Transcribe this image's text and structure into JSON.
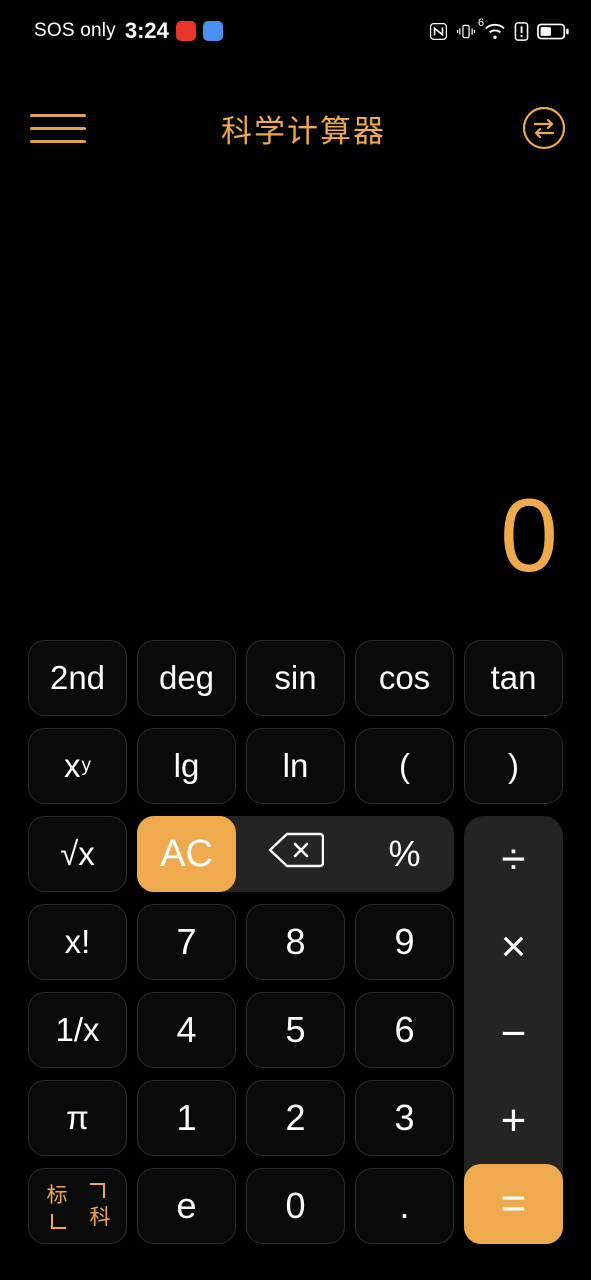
{
  "statusbar": {
    "carrier": "SOS only",
    "time": "3:24",
    "badges": [
      {
        "name": "notification-badge-red",
        "color": "#e8352b",
        "glyph": ""
      },
      {
        "name": "notification-badge-blue",
        "color": "#4a8ef0",
        "glyph": ""
      }
    ],
    "icons": [
      "nfc-icon",
      "vibrate-icon",
      "wifi6-icon",
      "sim-alert-icon",
      "battery-icon"
    ],
    "wifi_generation": "6"
  },
  "header": {
    "menu_icon": "hamburger-menu-icon",
    "title": "科学计算器",
    "swap_icon": "swap-convert-icon"
  },
  "display": {
    "value": "0"
  },
  "keypad": {
    "rows": [
      [
        {
          "label": "2nd",
          "name": "key-2nd",
          "style": "fn"
        },
        {
          "label": "deg",
          "name": "key-deg",
          "style": "fn"
        },
        {
          "label": "sin",
          "name": "key-sin",
          "style": "fn"
        },
        {
          "label": "cos",
          "name": "key-cos",
          "style": "fn"
        },
        {
          "label": "tan",
          "name": "key-tan",
          "style": "fn"
        }
      ],
      [
        {
          "label": "x",
          "sup": "y",
          "name": "key-power",
          "style": "fn"
        },
        {
          "label": "lg",
          "name": "key-lg",
          "style": "fn"
        },
        {
          "label": "ln",
          "name": "key-ln",
          "style": "fn"
        },
        {
          "label": "(",
          "name": "key-open-paren",
          "style": "fn"
        },
        {
          "label": ")",
          "name": "key-close-paren",
          "style": "fn"
        }
      ],
      [
        {
          "label": "√x",
          "name": "key-sqrt",
          "style": "fn"
        },
        {
          "label": "AC",
          "name": "key-all-clear",
          "style": "amber"
        },
        {
          "label": "",
          "name": "key-backspace",
          "style": "icon"
        },
        {
          "label": "%",
          "name": "key-percent",
          "style": "flat"
        }
      ],
      [
        {
          "label": "x!",
          "name": "key-factorial",
          "style": "fn"
        },
        {
          "label": "7",
          "name": "key-7",
          "style": "num"
        },
        {
          "label": "8",
          "name": "key-8",
          "style": "num"
        },
        {
          "label": "9",
          "name": "key-9",
          "style": "num"
        }
      ],
      [
        {
          "label": "1/x",
          "name": "key-reciprocal",
          "style": "fn"
        },
        {
          "label": "4",
          "name": "key-4",
          "style": "num"
        },
        {
          "label": "5",
          "name": "key-5",
          "style": "num"
        },
        {
          "label": "6",
          "name": "key-6",
          "style": "num"
        }
      ],
      [
        {
          "label": "π",
          "name": "key-pi",
          "style": "fn"
        },
        {
          "label": "1",
          "name": "key-1",
          "style": "num"
        },
        {
          "label": "2",
          "name": "key-2",
          "style": "num"
        },
        {
          "label": "3",
          "name": "key-3",
          "style": "num"
        }
      ],
      [
        {
          "label": "",
          "name": "key-mode-toggle",
          "style": "mode"
        },
        {
          "label": "e",
          "name": "key-e",
          "style": "num"
        },
        {
          "label": "0",
          "name": "key-0",
          "style": "num"
        },
        {
          "label": ".",
          "name": "key-decimal",
          "style": "num"
        }
      ]
    ],
    "mode_toggle": {
      "standard": "标",
      "scientific": "科"
    },
    "operators": [
      {
        "label": "÷",
        "name": "key-divide"
      },
      {
        "label": "×",
        "name": "key-multiply"
      },
      {
        "label": "−",
        "name": "key-subtract"
      },
      {
        "label": "+",
        "name": "key-add"
      },
      {
        "label": "=",
        "name": "key-equals"
      }
    ]
  },
  "colors": {
    "accent": "#eeaa4d",
    "background": "#000000",
    "key_fill": "#0a0a0a",
    "key_border": "#2d2d2d",
    "panel": "#242424",
    "text": "#ffffff"
  }
}
